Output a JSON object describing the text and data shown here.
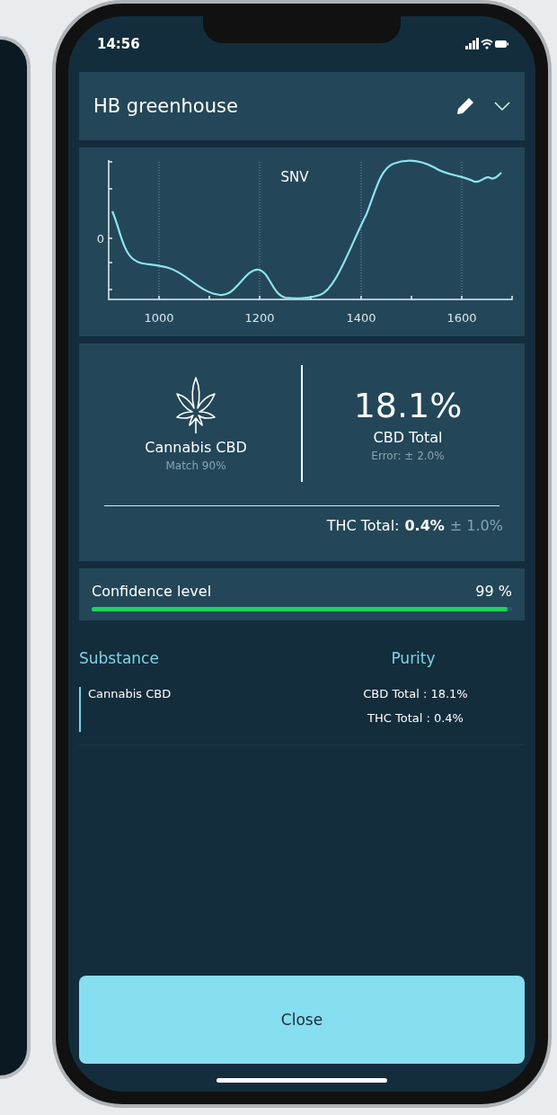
{
  "status_bar": {
    "time": "14:56"
  },
  "header": {
    "title": "HB greenhouse"
  },
  "chart": {
    "title": "SNV",
    "y_tick_label": "0",
    "x_tick_labels": [
      "1000",
      "1200",
      "1400",
      "1600"
    ]
  },
  "result": {
    "substance": "Cannabis CBD",
    "match": "Match 90%",
    "value": "18.1%",
    "value_label": "CBD Total",
    "value_error": "Error: ± 2.0%",
    "thc_label": "THC Total:",
    "thc_value": "0.4%",
    "thc_error": "± 1.0%"
  },
  "confidence": {
    "label": "Confidence level",
    "reading": "99 %",
    "level": 0.99
  },
  "table": {
    "columns": [
      "Substance",
      "Purity"
    ],
    "rows": [
      {
        "substance": "Cannabis CBD",
        "purity": [
          "CBD Total : 18.1%",
          "THC Total : 0.4%"
        ]
      }
    ]
  },
  "close_button": "Close"
}
